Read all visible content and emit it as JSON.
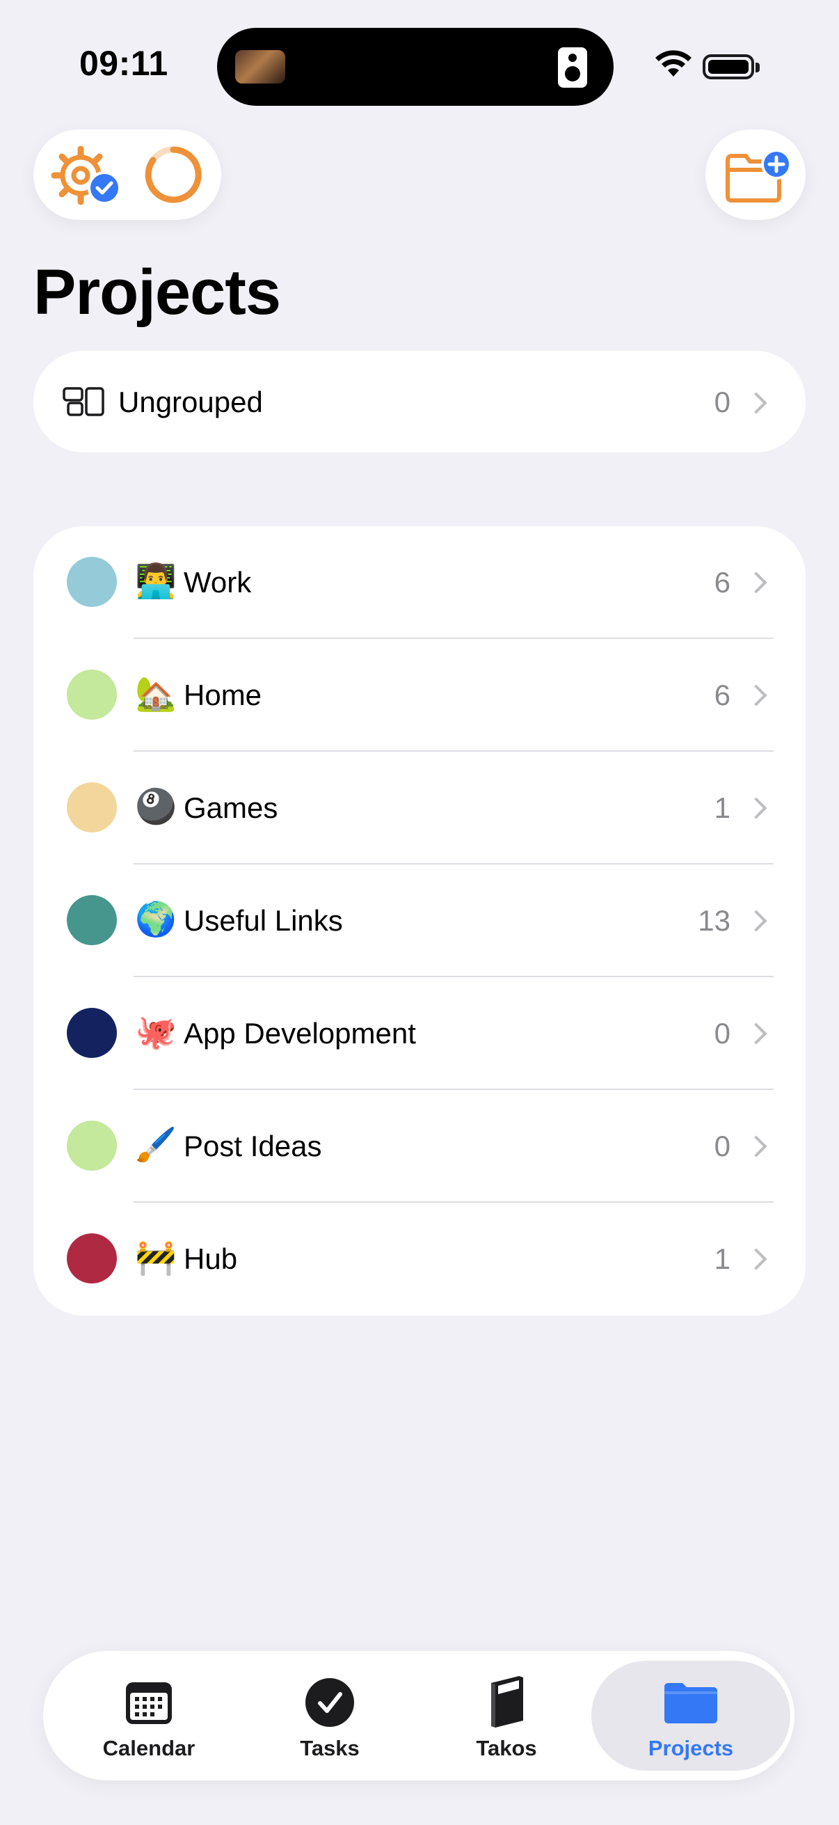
{
  "status_bar": {
    "time": "09:11"
  },
  "header": {
    "title": "Projects"
  },
  "ungrouped": {
    "label": "Ungrouped",
    "count": "0"
  },
  "projects": [
    {
      "emoji": "👨‍💻",
      "name": "Work",
      "count": "6",
      "color": "#95cad9"
    },
    {
      "emoji": "🏡",
      "name": "Home",
      "count": "6",
      "color": "#c4e89c"
    },
    {
      "emoji": "🎱",
      "name": "Games",
      "count": "1",
      "color": "#f3d69c"
    },
    {
      "emoji": "🌍",
      "name": "Useful Links",
      "count": "13",
      "color": "#46968e"
    },
    {
      "emoji": "🐙",
      "name": "App Development",
      "count": "0",
      "color": "#14235f"
    },
    {
      "emoji": "🖌️",
      "name": "Post Ideas",
      "count": "0",
      "color": "#c4e89c"
    },
    {
      "emoji": "🚧",
      "name": "Hub",
      "count": "1",
      "color": "#b02943"
    }
  ],
  "tabbar": {
    "tabs": [
      {
        "label": "Calendar",
        "icon": "calendar-icon"
      },
      {
        "label": "Tasks",
        "icon": "checkmark-circle-icon"
      },
      {
        "label": "Takos",
        "icon": "book-icon"
      },
      {
        "label": "Projects",
        "icon": "folder-icon",
        "active": true
      }
    ]
  },
  "colors": {
    "accent": "#3478f6",
    "orange": "#ef9138",
    "background": "#f1f0f6"
  }
}
